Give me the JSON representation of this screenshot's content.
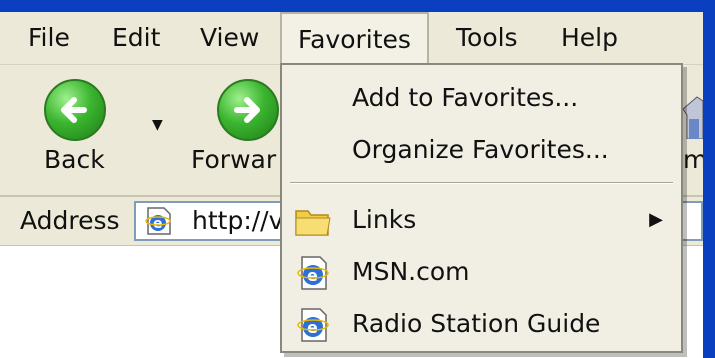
{
  "menubar": {
    "items": [
      {
        "label": "File"
      },
      {
        "label": "Edit"
      },
      {
        "label": "View"
      },
      {
        "label": "Favorites"
      },
      {
        "label": "Tools"
      },
      {
        "label": "Help"
      }
    ]
  },
  "toolbar": {
    "back_label": "Back",
    "forward_label": "Forwar",
    "home_partial_label": "me"
  },
  "address": {
    "label": "Address",
    "value": "http://v"
  },
  "favorites_menu": {
    "items": [
      {
        "label": "Add to Favorites..."
      },
      {
        "label": "Organize Favorites..."
      },
      {
        "label": "Links",
        "icon": "folder-icon",
        "has_submenu": true
      },
      {
        "label": "MSN.com",
        "icon": "ie-page-icon"
      },
      {
        "label": "Radio Station Guide",
        "icon": "ie-page-icon"
      }
    ]
  },
  "colors": {
    "window_border": "#0a3fbf",
    "chrome": "#ece9d8",
    "menu_bg": "#f1efe4"
  }
}
